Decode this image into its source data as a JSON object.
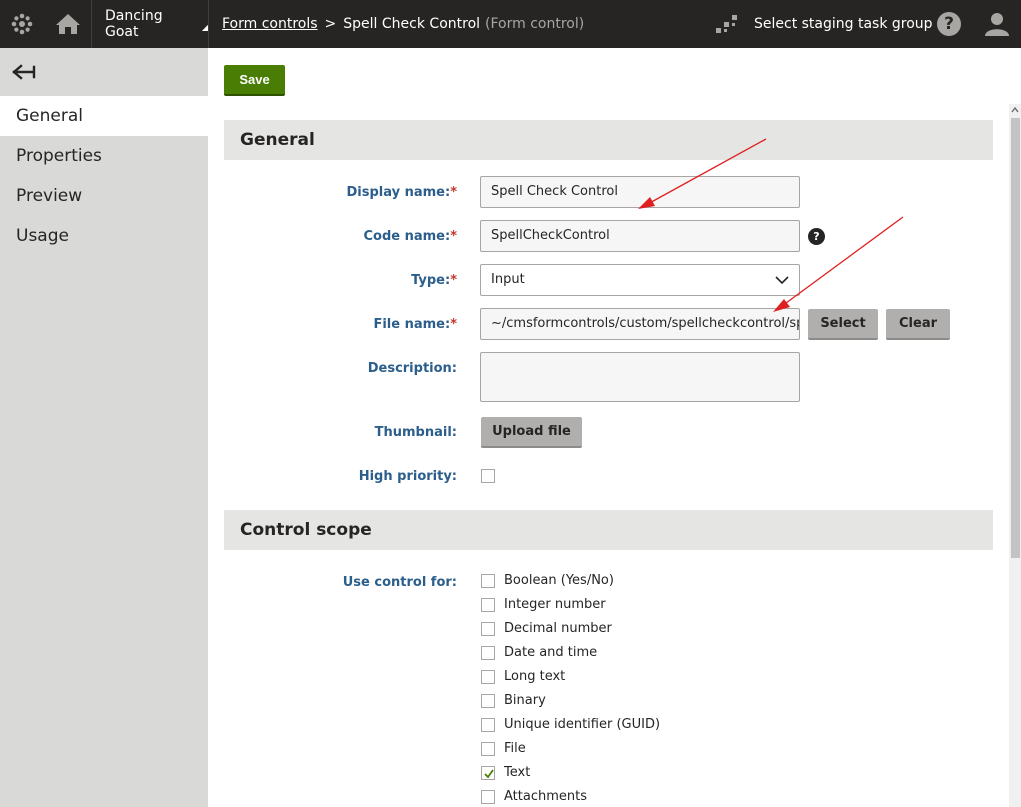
{
  "topbar": {
    "site_name": "Dancing Goat",
    "breadcrumb_link": "Form controls",
    "breadcrumb_current": "Spell Check Control",
    "breadcrumb_type": "(Form control)",
    "staging_label": "Select staging task group",
    "help_symbol": "?"
  },
  "sidebar": {
    "items": [
      {
        "label": "General",
        "active": true
      },
      {
        "label": "Properties",
        "active": false
      },
      {
        "label": "Preview",
        "active": false
      },
      {
        "label": "Usage",
        "active": false
      }
    ]
  },
  "actions": {
    "save_label": "Save"
  },
  "general": {
    "title": "General",
    "display_name_label": "Display name:",
    "display_name_value": "Spell Check Control",
    "code_name_label": "Code name:",
    "code_name_value": "SpellCheckControl",
    "type_label": "Type:",
    "type_value": "Input",
    "file_name_label": "File name:",
    "file_name_value": "~/cmsformcontrols/custom/spellcheckcontrol/spellcheckcontrol.ascx",
    "select_button": "Select",
    "clear_button": "Clear",
    "description_label": "Description:",
    "description_value": "",
    "thumbnail_label": "Thumbnail:",
    "upload_button": "Upload file",
    "high_priority_label": "High priority:",
    "high_priority_checked": false,
    "required_mark": "*",
    "help_symbol": "?"
  },
  "scope": {
    "title": "Control scope",
    "use_for_label": "Use control for:",
    "options": [
      {
        "label": "Boolean (Yes/No)",
        "checked": false
      },
      {
        "label": "Integer number",
        "checked": false
      },
      {
        "label": "Decimal number",
        "checked": false
      },
      {
        "label": "Date and time",
        "checked": false
      },
      {
        "label": "Long text",
        "checked": false
      },
      {
        "label": "Binary",
        "checked": false
      },
      {
        "label": "Unique identifier (GUID)",
        "checked": false
      },
      {
        "label": "File",
        "checked": false
      },
      {
        "label": "Text",
        "checked": true
      },
      {
        "label": "Attachments",
        "checked": false
      }
    ]
  },
  "colors": {
    "topbar": "#262524",
    "sidebar": "#d9d9d7",
    "save_button": "#497d04",
    "label_blue": "#2c5e8c",
    "required": "#c0392b",
    "annotation_arrow": "#e02020"
  }
}
